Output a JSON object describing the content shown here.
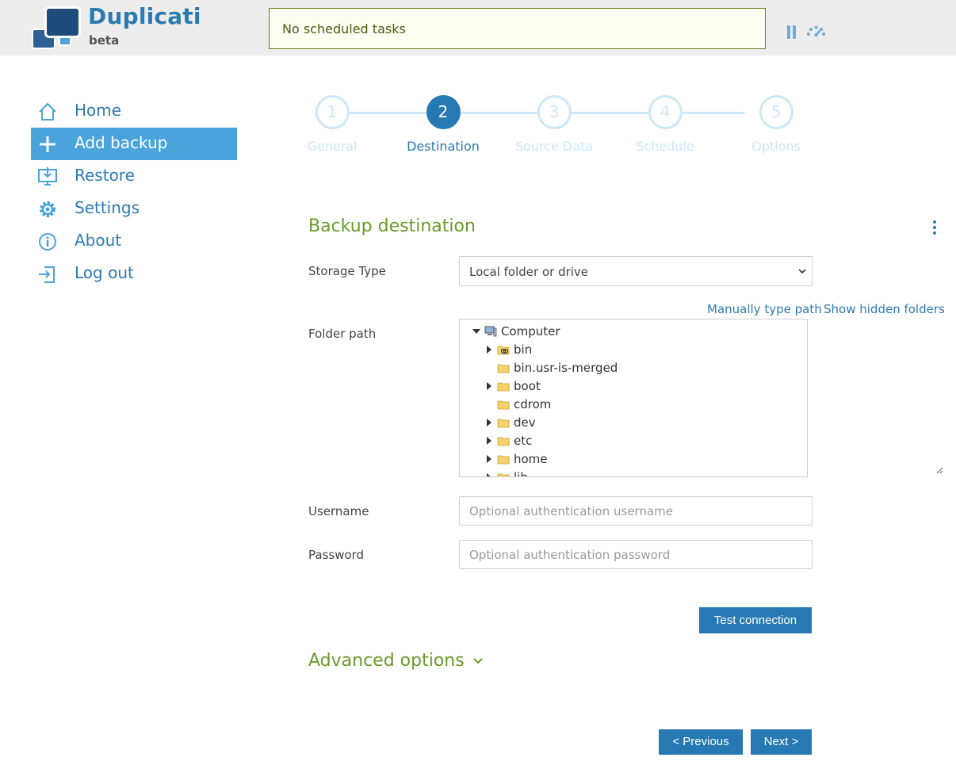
{
  "header": {
    "brand": "Duplicati",
    "brand_sub": "beta",
    "status": "No scheduled tasks",
    "pause_icon": "pause-icon",
    "speed_icon": "throttle-gauge-icon"
  },
  "sidebar": {
    "items": [
      {
        "label": "Home",
        "icon": "home-icon",
        "active": false
      },
      {
        "label": "Add backup",
        "icon": "plus-icon",
        "active": true
      },
      {
        "label": "Restore",
        "icon": "restore-monitor-icon",
        "active": false
      },
      {
        "label": "Settings",
        "icon": "gear-icon",
        "active": false
      },
      {
        "label": "About",
        "icon": "info-icon",
        "active": false
      },
      {
        "label": "Log out",
        "icon": "logout-icon",
        "active": false
      }
    ]
  },
  "steps": [
    {
      "number": "1",
      "label": "General",
      "active": false
    },
    {
      "number": "2",
      "label": "Destination",
      "active": true
    },
    {
      "number": "3",
      "label": "Source Data",
      "active": false
    },
    {
      "number": "4",
      "label": "Schedule",
      "active": false
    },
    {
      "number": "5",
      "label": "Options",
      "active": false
    }
  ],
  "form": {
    "title": "Backup destination",
    "storage_type_label": "Storage Type",
    "storage_type_value": "Local folder or drive",
    "manual_path_link": "Manually type path",
    "show_hidden_link": "Show hidden folders",
    "folder_path_label": "Folder path",
    "tree": {
      "root": "Computer",
      "items": [
        {
          "name": "bin",
          "expandable": true,
          "linked": true
        },
        {
          "name": "bin.usr-is-merged",
          "expandable": false,
          "linked": false
        },
        {
          "name": "boot",
          "expandable": true,
          "linked": false
        },
        {
          "name": "cdrom",
          "expandable": false,
          "linked": false
        },
        {
          "name": "dev",
          "expandable": true,
          "linked": false
        },
        {
          "name": "etc",
          "expandable": true,
          "linked": false
        },
        {
          "name": "home",
          "expandable": true,
          "linked": false
        },
        {
          "name": "lib",
          "expandable": true,
          "linked": true
        }
      ]
    },
    "username_label": "Username",
    "username_placeholder": "Optional authentication username",
    "password_label": "Password",
    "password_placeholder": "Optional authentication password",
    "test_button": "Test connection",
    "advanced_label": "Advanced options"
  },
  "footer": {
    "previous": "< Previous",
    "next": "Next >"
  },
  "colors": {
    "brand_blue": "#2d7ab0",
    "active_step": "#2679b2",
    "inactive_step": "#cde8f6",
    "section_green": "#6b9a2b",
    "nav_active_bg": "#4aa3db"
  }
}
